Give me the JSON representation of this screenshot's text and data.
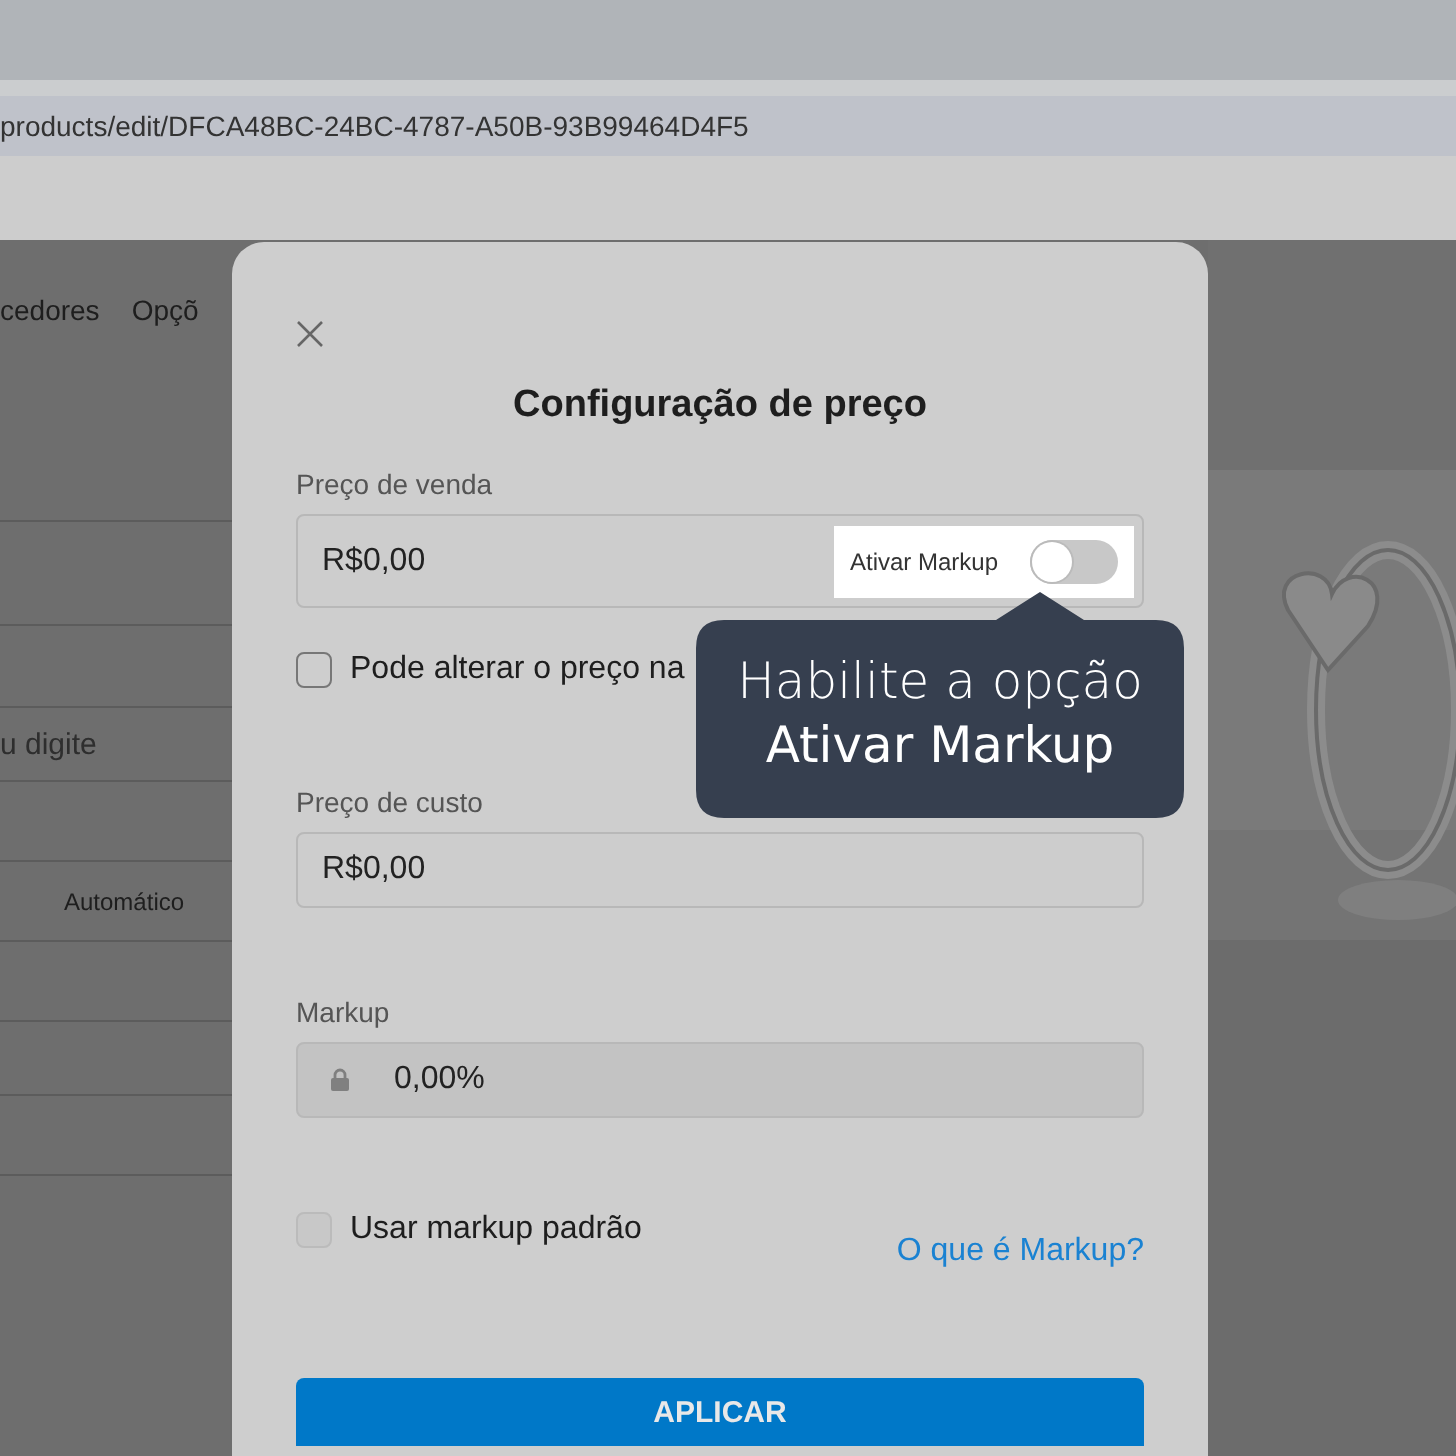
{
  "browser": {
    "address": "products/edit/DFCA48BC-24BC-4787-A50B-93B99464D4F5"
  },
  "page": {
    "nav_items": [
      "cedores",
      "Opçõ"
    ],
    "search_placeholder": "u digite",
    "automatic_label": "Automático"
  },
  "modal": {
    "title": "Configuração de preço",
    "sale_price": {
      "label": "Preço de venda",
      "value": "R$0,00",
      "markup_toggle": {
        "label": "Ativar Markup",
        "on": false
      }
    },
    "price_change": {
      "label": "Pode alterar o preço na",
      "checked": false
    },
    "cost_price": {
      "label": "Preço de custo",
      "value": "R$0,00"
    },
    "markup": {
      "label": "Markup",
      "value": "0,00%",
      "disabled": true
    },
    "default_markup": {
      "label": "Usar markup padrão",
      "checked": false
    },
    "help_link": "O que é Markup?",
    "apply_button": "APLICAR"
  },
  "tooltip": {
    "text": "Habilite a opção **Ativar Markup**"
  }
}
